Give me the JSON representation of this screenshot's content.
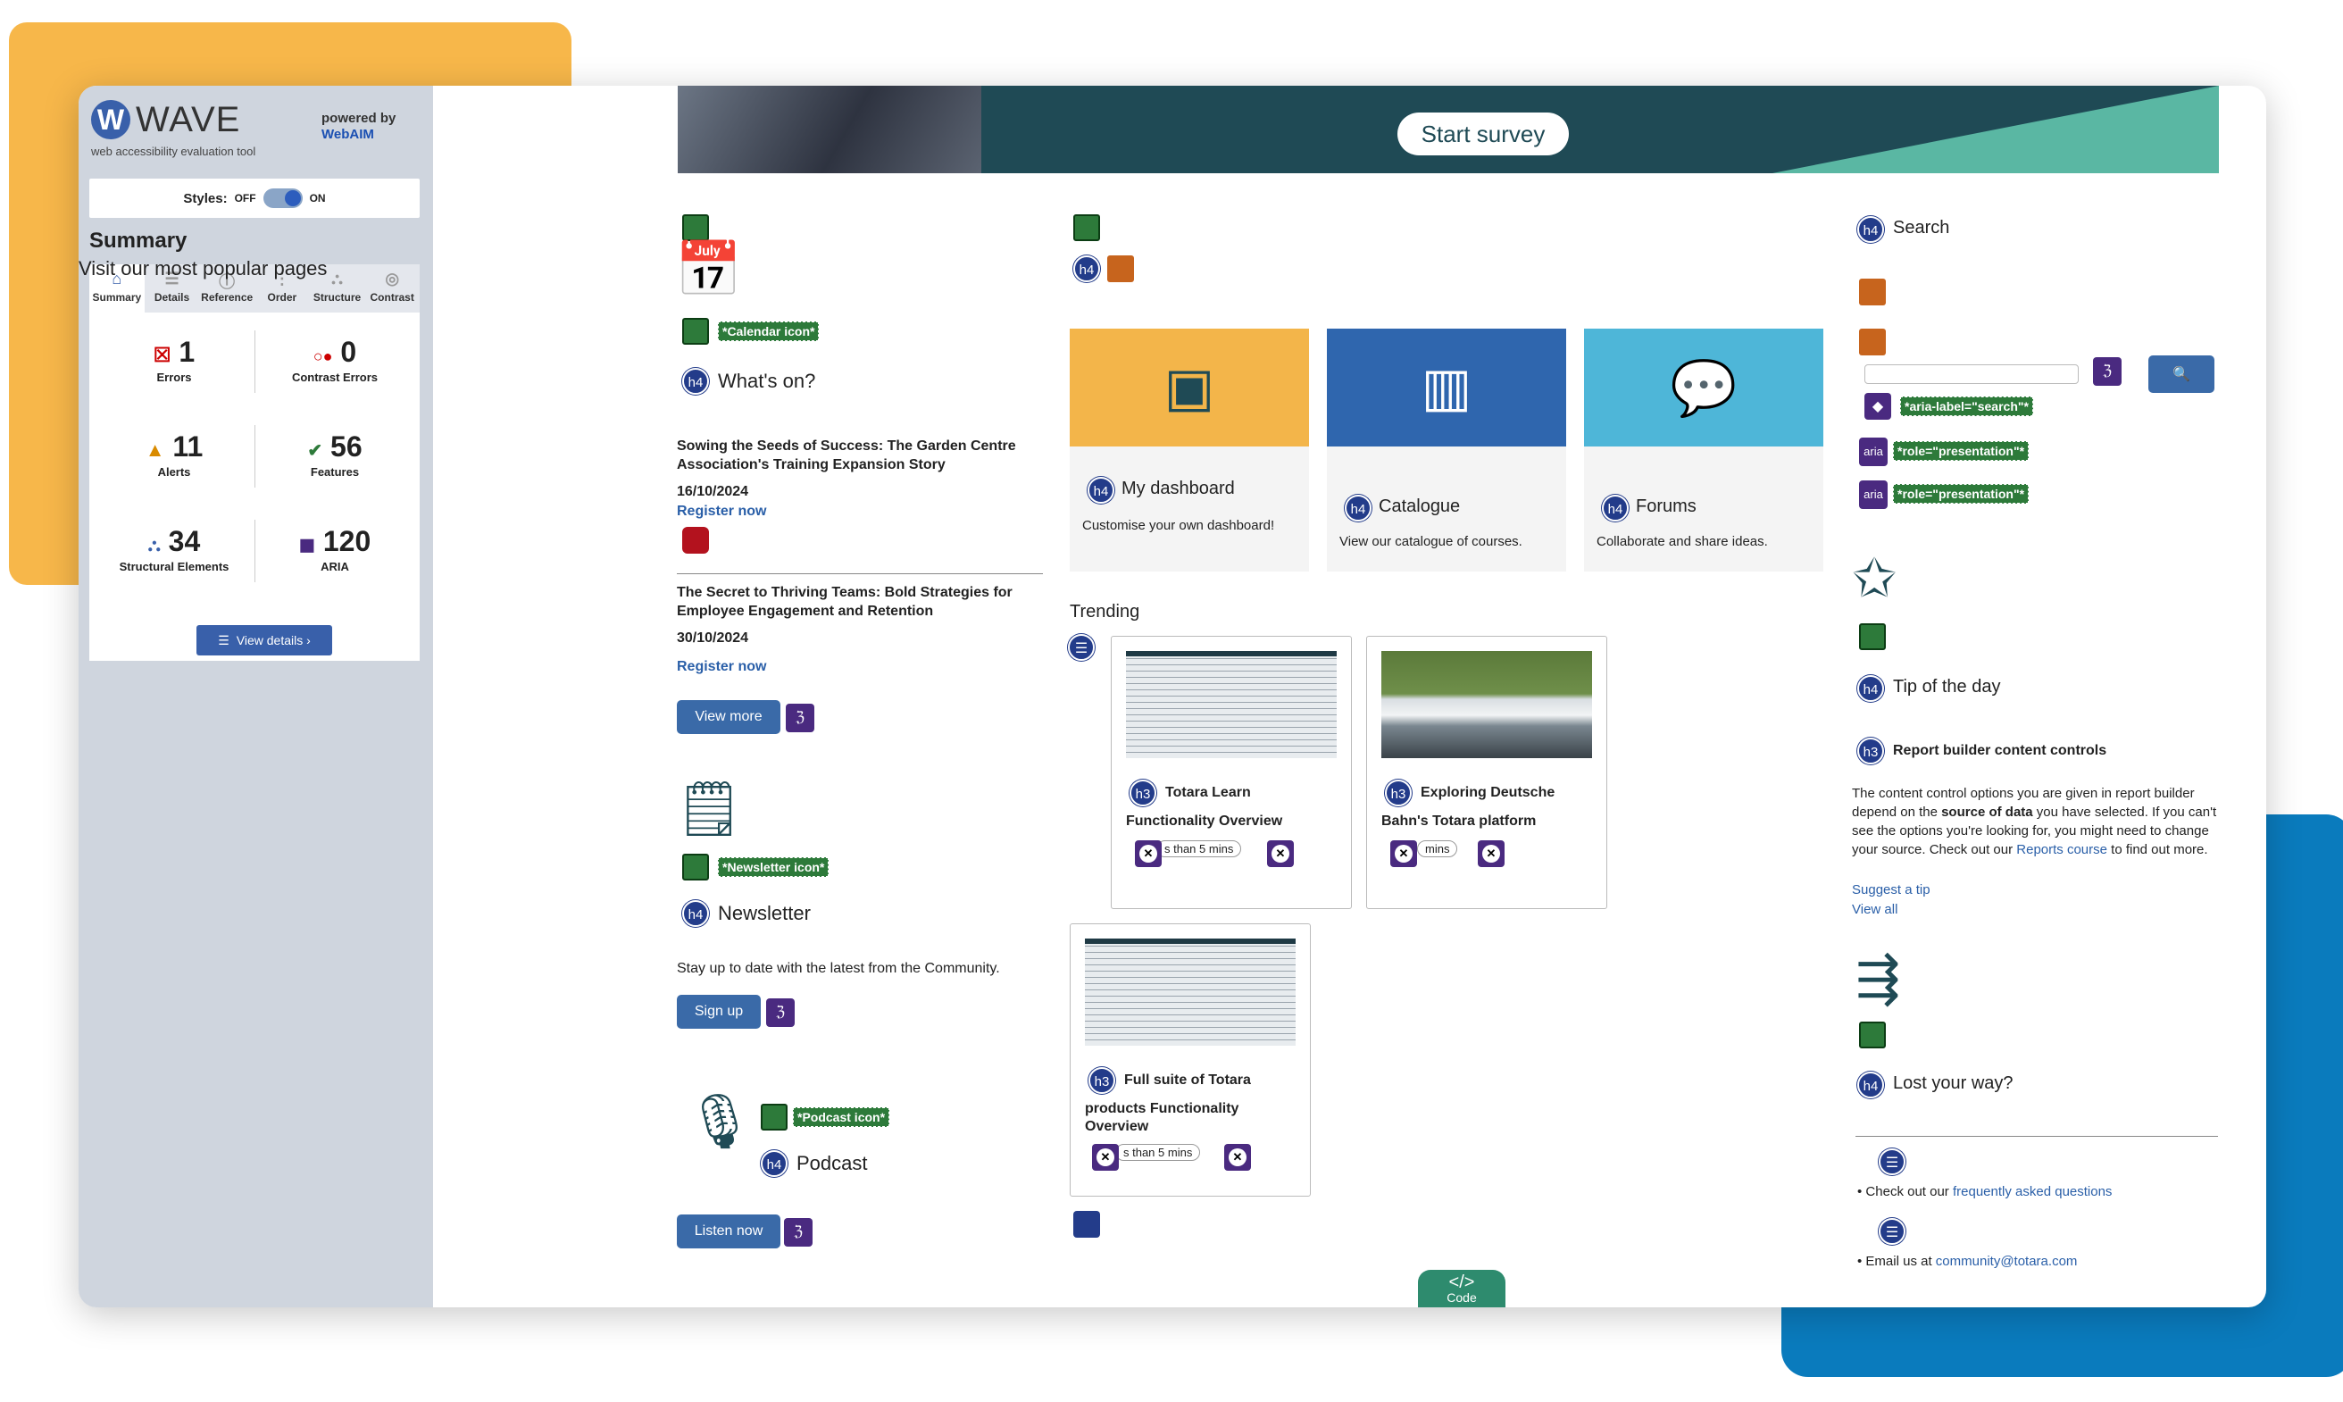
{
  "wave": {
    "logo": "WAVE",
    "subtitle": "web accessibility evaluation tool",
    "powered_by": "powered by",
    "webaim": "WebAIM",
    "styles_label": "Styles:",
    "styles_off": "OFF",
    "styles_on": "ON",
    "summary_title": "Summary",
    "tabs": [
      "Summary",
      "Details",
      "Reference",
      "Order",
      "Structure",
      "Contrast"
    ],
    "stats": {
      "errors": {
        "value": "1",
        "label": "Errors"
      },
      "contrast": {
        "value": "0",
        "label": "Contrast Errors"
      },
      "alerts": {
        "value": "11",
        "label": "Alerts"
      },
      "features": {
        "value": "56",
        "label": "Features"
      },
      "structural": {
        "value": "34",
        "label": "Structural Elements"
      },
      "aria": {
        "value": "120",
        "label": "ARIA"
      }
    },
    "view_details": "View details ›"
  },
  "banner": {
    "survey": "Start survey"
  },
  "icons": {
    "h4": "h4",
    "h3": "h3",
    "aria": "aria"
  },
  "left": {
    "calendar_tag": "*Calendar icon*",
    "whats_on": "What's on?",
    "event1_title": "Sowing the Seeds of Success: The Garden Centre Association's Training Expansion Story",
    "event1_date": "16/10/2024",
    "register": "Register now",
    "event2_title": "The Secret to Thriving Teams: Bold Strategies for Employee Engagement and Retention",
    "event2_date": "30/10/2024",
    "view_more": "View more",
    "newsletter_tag": "*Newsletter icon*",
    "newsletter": "Newsletter",
    "newsletter_text": "Stay up to date with the latest from the Community.",
    "sign_up": "Sign up",
    "podcast_tag": "*Podcast icon*",
    "podcast": "Podcast",
    "listen_now": "Listen now"
  },
  "middle": {
    "popular": "Visit our most popular pages",
    "cards": [
      {
        "title": "My dashboard",
        "desc": "Customise your own dashboard!",
        "color": "#f3b54a"
      },
      {
        "title": "Catalogue",
        "desc": "View our catalogue of courses.",
        "color": "#2f66ae"
      },
      {
        "title": "Forums",
        "desc": "Collaborate and share ideas.",
        "color": "#4eb6d8"
      }
    ],
    "trending": "Trending",
    "trend_items": [
      {
        "title1": "Totara Learn",
        "title2": "Functionality Overview",
        "pill": "s than 5 mins"
      },
      {
        "title1": "Exploring Deutsche",
        "title2": "Bahn's Totara platform",
        "pill": "mins"
      },
      {
        "title1": "Full suite of Totara",
        "title2": "products Functionality",
        "title3": "Overview",
        "pill": "s than 5 mins"
      }
    ]
  },
  "right": {
    "search": "Search",
    "aria_label_tag": "*aria-label=\"search\"*",
    "role_tag": "*role=\"presentation\"*",
    "tip_of_day": "Tip of the day",
    "report_title": "Report builder content controls",
    "tip_text1": "The content control options you are given in report builder depend on the ",
    "tip_bold": "source of data",
    "tip_text2": " you have selected. If you can't see the options you're looking for, you might need to change your source. Check out our ",
    "reports_course": "Reports course",
    "tip_text3": " to find out more.",
    "suggest": "Suggest a tip",
    "view_all": "View all",
    "lost": "Lost your way?",
    "faq_pre": "Check out our ",
    "faq_link": "frequently asked questions",
    "email_pre": "Email us at ",
    "email_link": "community@totara.com"
  },
  "code_tab": "Code"
}
